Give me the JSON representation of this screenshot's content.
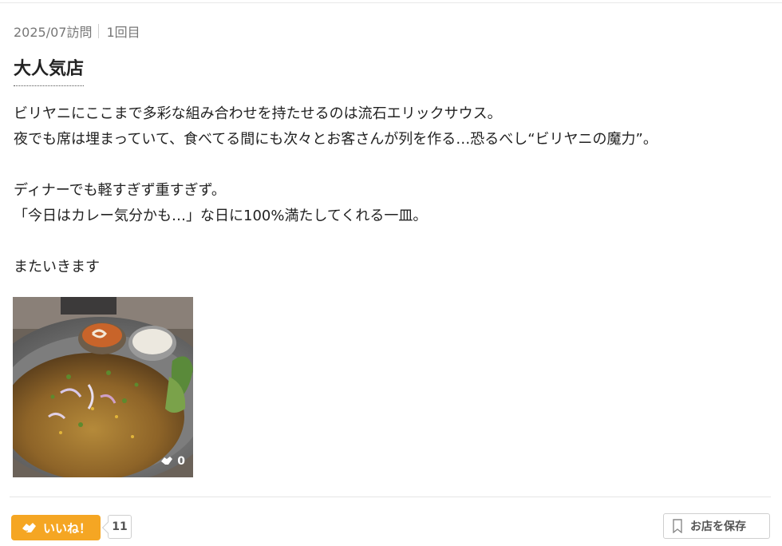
{
  "visit": {
    "date": "2025/07訪問",
    "count": "1回目"
  },
  "review": {
    "title": "大人気店",
    "lines": [
      "ビリヤニにここまで多彩な組み合わせを持たせるのは流石エリックサウス。",
      "夜でも席は埋まっていて、食べてる間にも次々とお客さんが列を作る…恐るべし“ビリヤニの魔力”。",
      "",
      "ディナーでも軽すぎず重すぎず。",
      "「今日はカレー気分かも…」な日に100%満たしてくれる一皿。",
      "",
      "またいきます"
    ]
  },
  "photo": {
    "like_count": "0",
    "icon": "like-hand-icon"
  },
  "actions": {
    "like_label": "いいね！",
    "like_count": "11",
    "save_label": "お店を保存",
    "like_color": "#f5a623"
  }
}
